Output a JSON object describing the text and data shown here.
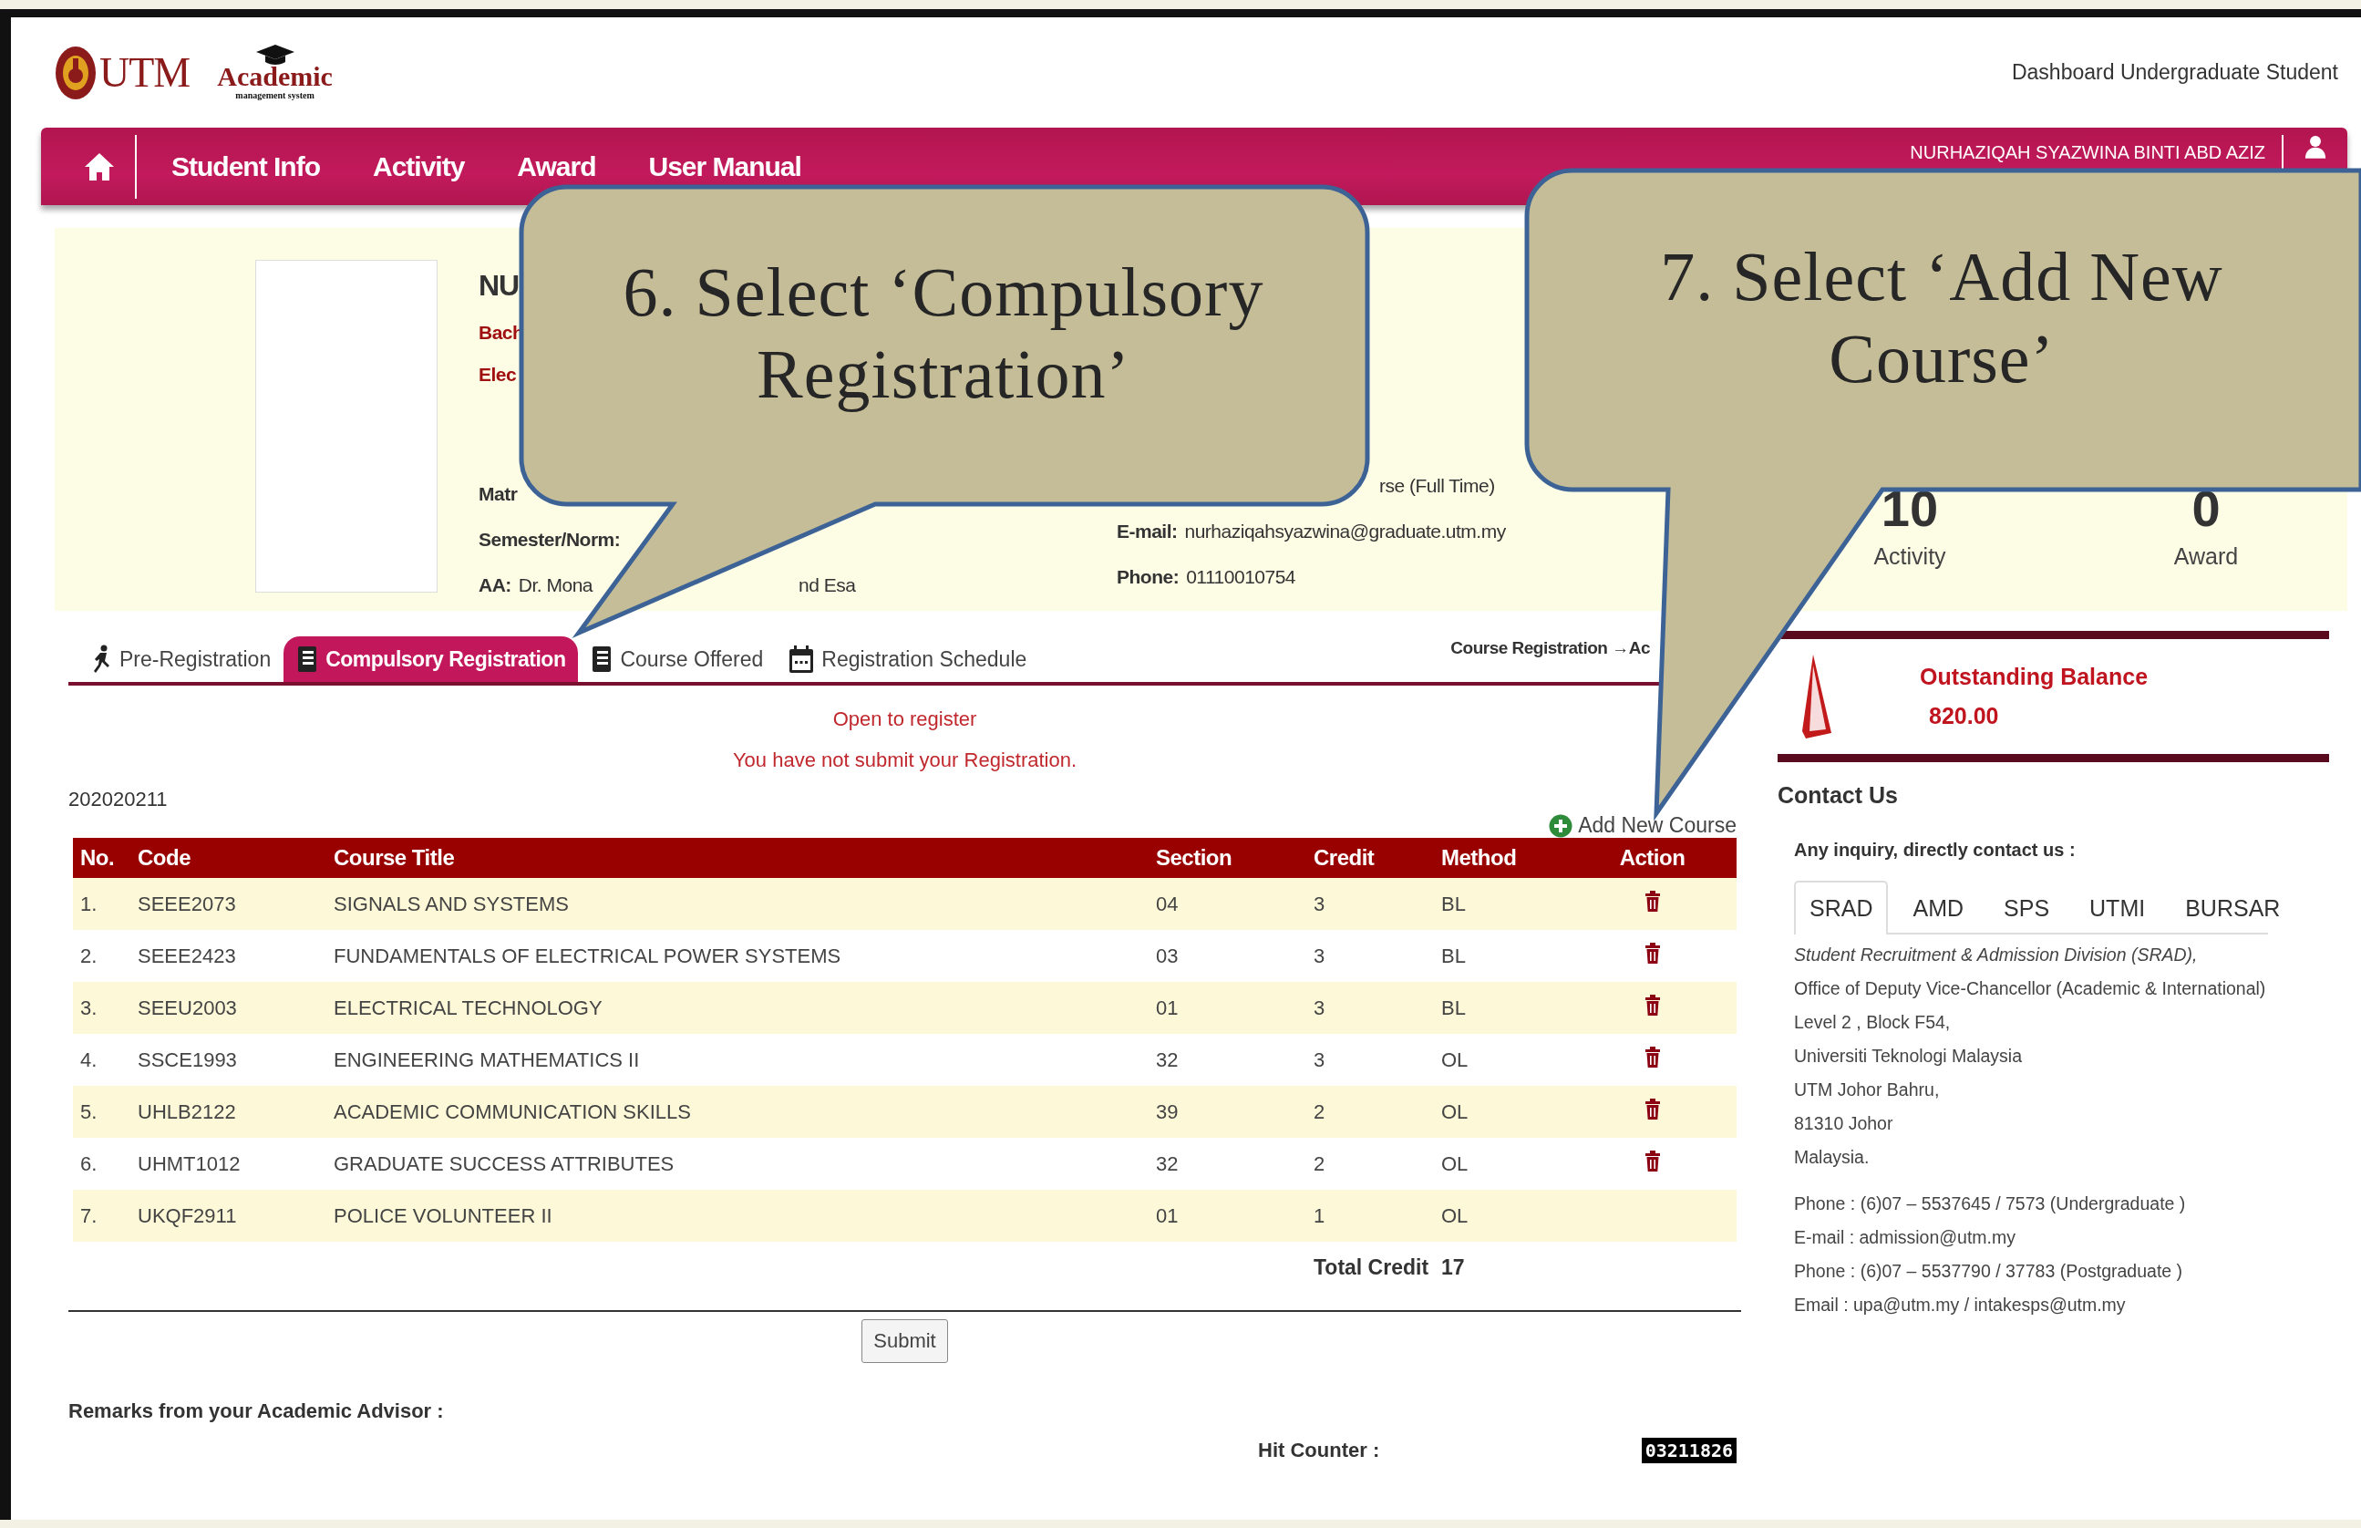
{
  "header": {
    "logo_text": "UTM",
    "app_name": "Academic",
    "app_tagline": "management system",
    "subtitle": "Dashboard Undergraduate Student"
  },
  "nav": {
    "items": [
      "Student Info",
      "Activity",
      "Award",
      "User Manual"
    ],
    "user": "NURHAZIQAH SYAZWINA BINTI ABD AZIZ"
  },
  "profile": {
    "name": "NU",
    "program_lines": [
      "Bach",
      "Elec"
    ],
    "matric_label": "Matr",
    "semester_label": "Semester/Norm:",
    "advisor": {
      "label": "AA:",
      "value_start": "Dr. Mona",
      "value_end": "nd Esa"
    },
    "status_value": "rse (Full Time)",
    "email": {
      "label": "E-mail:",
      "value": "nurhaziqahsyazwina@graduate.utm.my"
    },
    "phone": {
      "label": "Phone:",
      "value": "01110010754"
    },
    "stats": [
      {
        "value": "10",
        "label": "Activity"
      },
      {
        "value": "0",
        "label": "Award"
      }
    ]
  },
  "reg_tabs": [
    {
      "label": "Pre-Registration",
      "kind": "runner",
      "selected": false
    },
    {
      "label": "Compulsory Registration",
      "kind": "book",
      "selected": true
    },
    {
      "label": "Course Offered",
      "kind": "book",
      "selected": false
    },
    {
      "label": "Registration Schedule",
      "kind": "calendar",
      "selected": false
    }
  ],
  "breadcrumb": "Course Registration →Ac",
  "messages": [
    "Open to register",
    "You have not submit your Registration."
  ],
  "session": "202020211",
  "add_course": "Add New Course",
  "table": {
    "columns": [
      "No.",
      "Code",
      "Course Title",
      "Section",
      "Credit",
      "Method",
      "Action"
    ],
    "rows": [
      {
        "no": "1.",
        "code": "SEEE2073",
        "title": "SIGNALS AND SYSTEMS",
        "section": "04",
        "credit": "3",
        "method": "BL",
        "removable": true
      },
      {
        "no": "2.",
        "code": "SEEE2423",
        "title": "FUNDAMENTALS OF ELECTRICAL POWER SYSTEMS",
        "section": "03",
        "credit": "3",
        "method": "BL",
        "removable": true
      },
      {
        "no": "3.",
        "code": "SEEU2003",
        "title": "ELECTRICAL TECHNOLOGY",
        "section": "01",
        "credit": "3",
        "method": "BL",
        "removable": true
      },
      {
        "no": "4.",
        "code": "SSCE1993",
        "title": "ENGINEERING MATHEMATICS II",
        "section": "32",
        "credit": "3",
        "method": "OL",
        "removable": true
      },
      {
        "no": "5.",
        "code": "UHLB2122",
        "title": "ACADEMIC COMMUNICATION SKILLS",
        "section": "39",
        "credit": "2",
        "method": "OL",
        "removable": true
      },
      {
        "no": "6.",
        "code": "UHMT1012",
        "title": "GRADUATE SUCCESS ATTRIBUTES",
        "section": "32",
        "credit": "2",
        "method": "OL",
        "removable": true
      },
      {
        "no": "7.",
        "code": "UKQF2911",
        "title": "POLICE VOLUNTEER II",
        "section": "01",
        "credit": "1",
        "method": "OL",
        "removable": false
      }
    ],
    "total_label": "Total Credit",
    "total": "17"
  },
  "submit": "Submit",
  "remarks": "Remarks from your Academic Advisor :",
  "hit_counter": {
    "label": "Hit Counter :",
    "value": "03211826"
  },
  "balance": {
    "label": "Outstanding Balance",
    "amount": "820.00"
  },
  "contact": {
    "title": "Contact Us",
    "intro": "Any inquiry, directly contact us :",
    "tabs": [
      {
        "label": "SRAD",
        "selected": true
      },
      {
        "label": "AMD",
        "selected": false
      },
      {
        "label": "SPS",
        "selected": false
      },
      {
        "label": "UTMI",
        "selected": false
      },
      {
        "label": "BURSAR",
        "selected": false
      }
    ],
    "division": "Student Recruitment & Admission Division (SRAD),",
    "address": [
      "Office of Deputy Vice-Chancellor (Academic & International)",
      "Level 2 , Block F54,",
      "Universiti Teknologi Malaysia",
      "UTM Johor Bahru,",
      "81310 Johor",
      "Malaysia."
    ],
    "details": [
      "Phone : (6)07 – 5537645 / 7573 (Undergraduate )",
      "E-mail : admission@utm.my",
      "Phone : (6)07 – 5537790 / 37783 (Postgraduate )",
      "Email : upa@utm.my / intakesps@utm.my"
    ]
  },
  "callouts": [
    {
      "text": "6. Select ‘Compulsory Registration’"
    },
    {
      "text": "7. Select ‘Add New Course’"
    }
  ]
}
